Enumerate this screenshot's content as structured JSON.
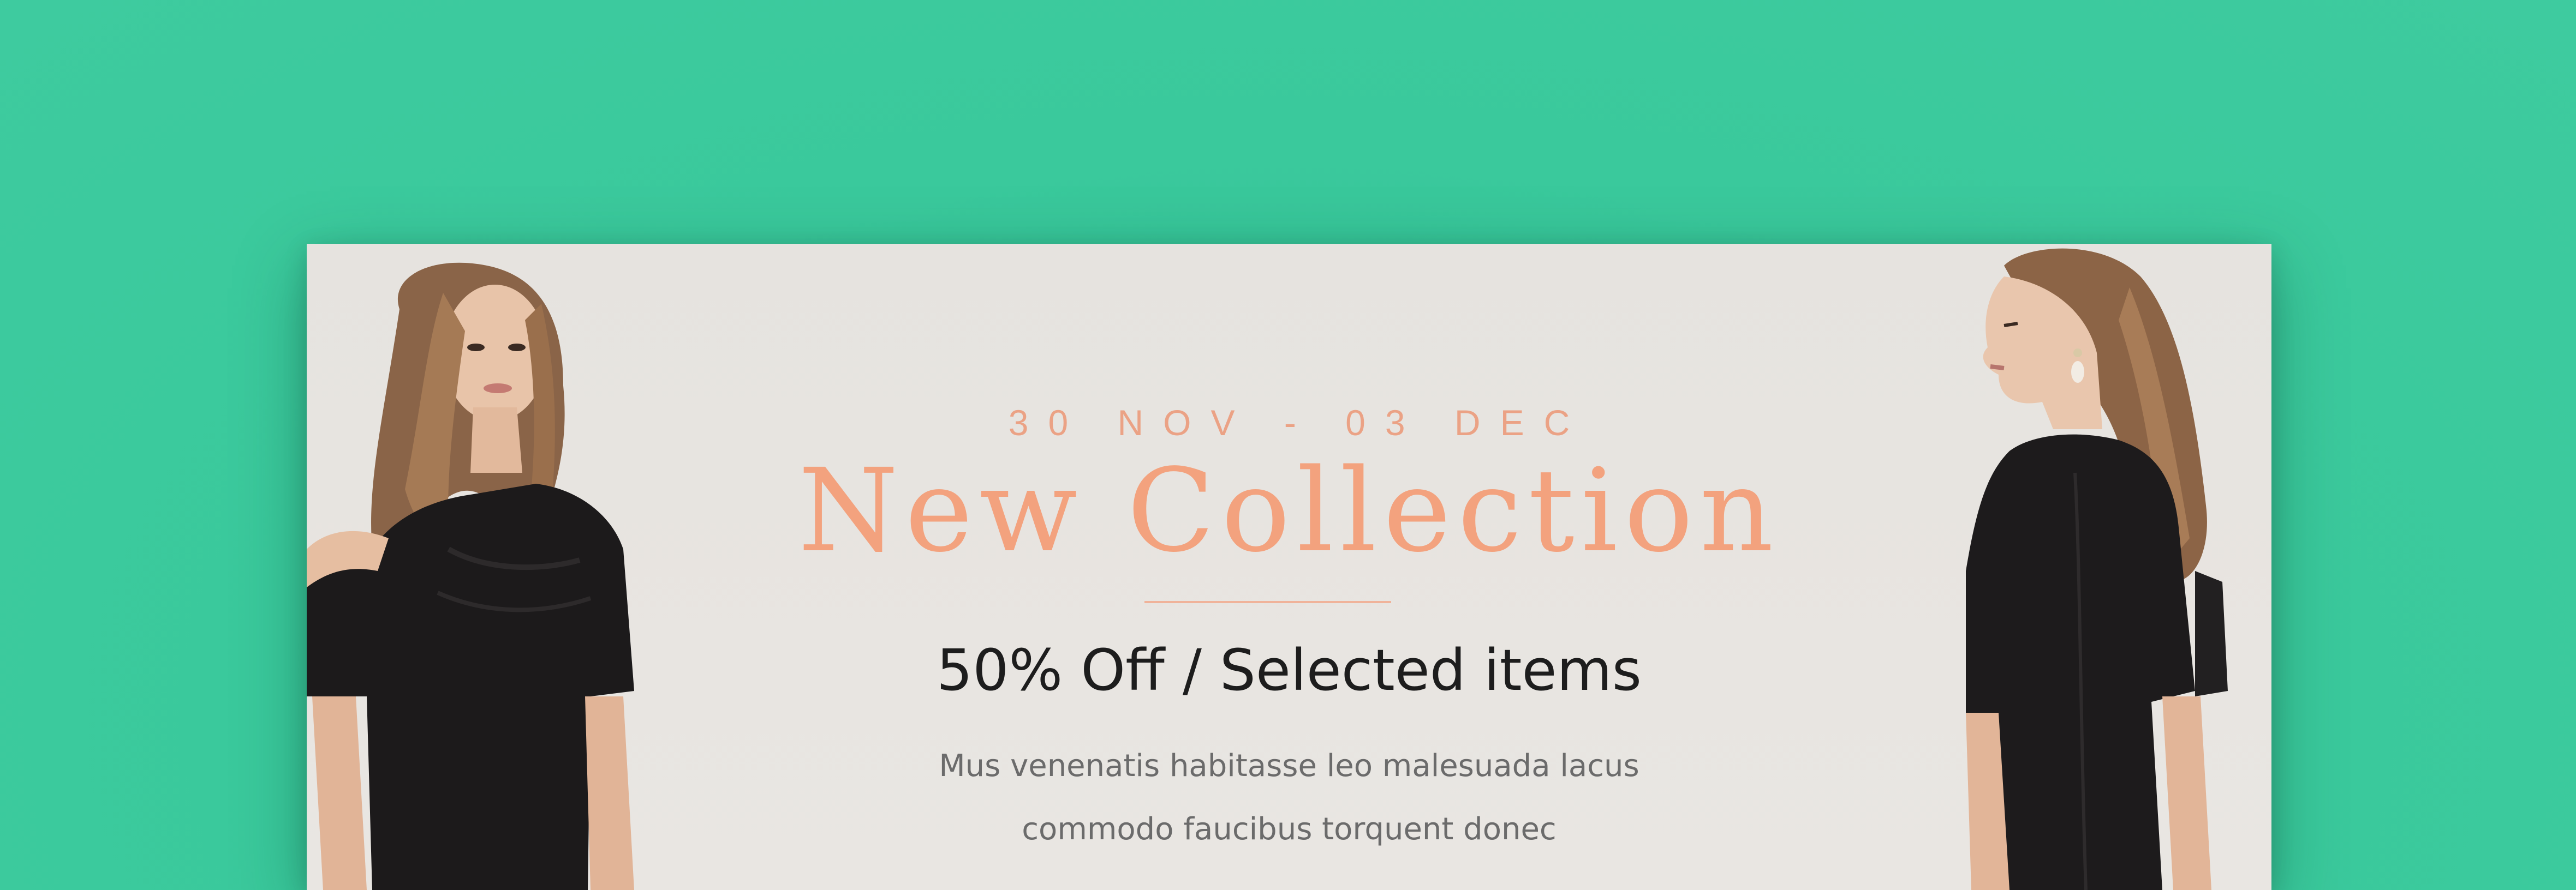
{
  "banner": {
    "date": "30 NOV - 03 DEC",
    "title": "New Collection",
    "subtitle": "50% Off / Selected items",
    "description_lines": [
      "Mus venenatis habitasse leo malesuada lacus",
      "commodo faucibus torquent donec"
    ]
  },
  "colors": {
    "background": "#3cc99d",
    "banner": "#e7e4e0",
    "accent": "#f3a27e",
    "subtitle": "#1d1d1d",
    "body": "#6b6b6b"
  },
  "images": {
    "left": "model-black-dress-off-shoulder",
    "right": "model-black-dress-side-profile"
  }
}
